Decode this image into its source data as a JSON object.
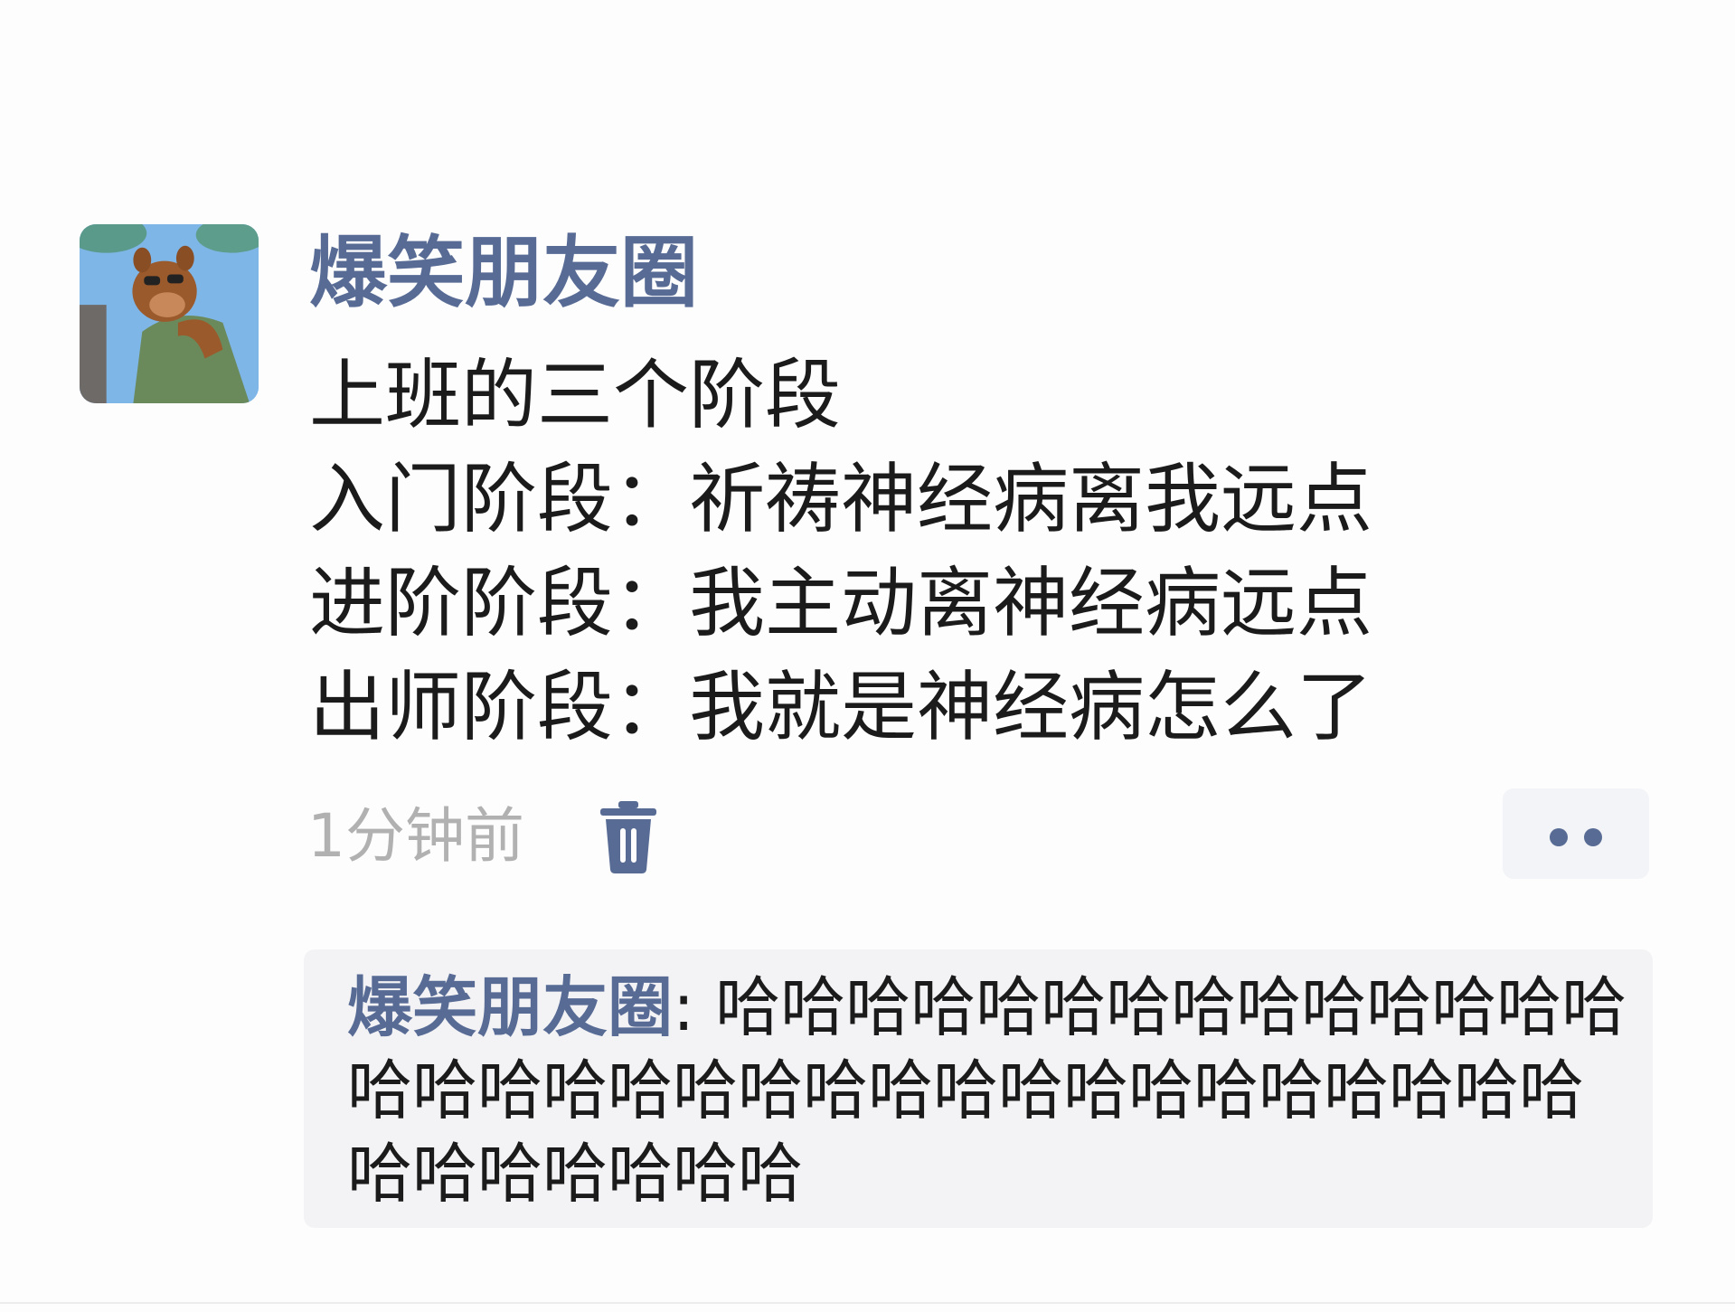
{
  "post": {
    "author": "爆笑朋友圈",
    "avatar_icon": "cartoon-bear-avatar",
    "lines": [
      "上班的三个阶段",
      "入门阶段：祈祷神经病离我远点",
      "进阶阶段：我主动离神经病远点",
      "出师阶段：我就是神经病怎么了"
    ],
    "time": "1分钟前",
    "delete_icon": "trash-icon",
    "more_icon": "more-dots-icon"
  },
  "comment": {
    "author": "爆笑朋友圈",
    "separator": ": ",
    "text": "哈哈哈哈哈哈哈哈哈哈哈哈哈哈哈哈哈哈哈哈哈哈哈哈哈哈哈哈哈哈哈哈哈哈哈哈哈哈哈哈"
  },
  "colors": {
    "link": "#576b95",
    "text": "#1b1b1b",
    "muted": "#b1b1b1",
    "comment_bg": "#f3f3f5"
  }
}
